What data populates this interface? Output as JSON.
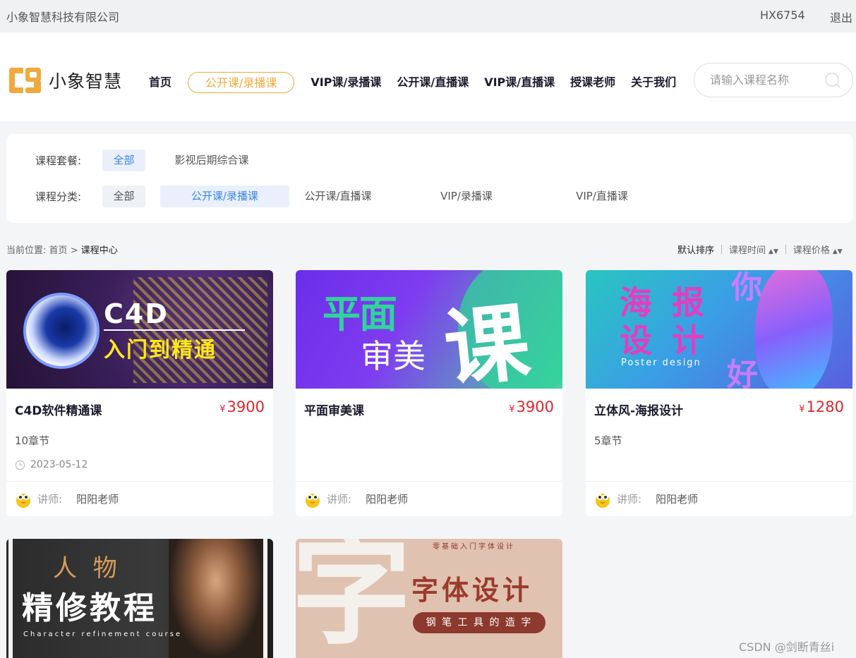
{
  "topbar": {
    "company": "小象智慧科技有限公司",
    "user_id": "HX6754",
    "logout": "退出"
  },
  "logo": {
    "text": "小象智慧",
    "icon": "logo-c9-icon",
    "color": "#f0a93b"
  },
  "nav": {
    "items": [
      "首页",
      "公开课/录播课",
      "VIP课/录播课",
      "公开课/直播课",
      "VIP课/直播课",
      "授课老师",
      "关于我们"
    ],
    "active_index": 1,
    "accent": "#f0a93b"
  },
  "search": {
    "placeholder": "请输入课程名称",
    "icon": "search-icon"
  },
  "filter": {
    "package_label": "课程套餐:",
    "package_options": [
      "全部",
      "影视后期综合课"
    ],
    "category_label": "课程分类:",
    "category_options": [
      "全部",
      "公开课/录播课",
      "公开课/直播课",
      "VIP/录播课",
      "VIP/直播课"
    ],
    "selected_color": "#3a84e8"
  },
  "breadcrumb": {
    "prefix": "当前位置:",
    "home": "首页",
    "sep": ">",
    "current": "课程中心"
  },
  "sort": {
    "default": "默认排序",
    "time": "课程时间",
    "price": "课程价格"
  },
  "courses": [
    {
      "title": "C4D软件精通课",
      "price": "3900",
      "chapters": "10章节",
      "date": "2023-05-12",
      "teacher_label": "讲师:",
      "teacher": "阳阳老师",
      "cover": {
        "line1": "C4D",
        "line2": "入门到精通"
      }
    },
    {
      "title": "平面审美课",
      "price": "3900",
      "chapters": "",
      "date": "",
      "teacher_label": "讲师:",
      "teacher": "阳阳老师",
      "cover": {
        "line1": "平面",
        "line2": "审美",
        "big": "课"
      }
    },
    {
      "title": "立体风-海报设计",
      "price": "1280",
      "chapters": "5章节",
      "date": "",
      "teacher_label": "讲师:",
      "teacher": "阳阳老师",
      "cover": {
        "line1": "海 报",
        "line2": "设 计",
        "sub": "Poster design",
        "side": "你",
        "side2": "好"
      }
    },
    {
      "title": "",
      "price": "",
      "chapters": "",
      "date": "",
      "teacher_label": "",
      "teacher": "",
      "cover": {
        "line1": "人 物",
        "line2": "精修教程",
        "sub": "Character refinement course"
      }
    },
    {
      "title": "",
      "price": "",
      "chapters": "",
      "date": "",
      "teacher_label": "",
      "teacher": "",
      "cover": {
        "top": "零基础入门字体设计",
        "big": "字",
        "line1": "字体设计",
        "line2": "钢 笔 工 具 的 造 字"
      }
    }
  ],
  "currency_symbol": "¥",
  "watermark": "CSDN @剑断青丝i"
}
